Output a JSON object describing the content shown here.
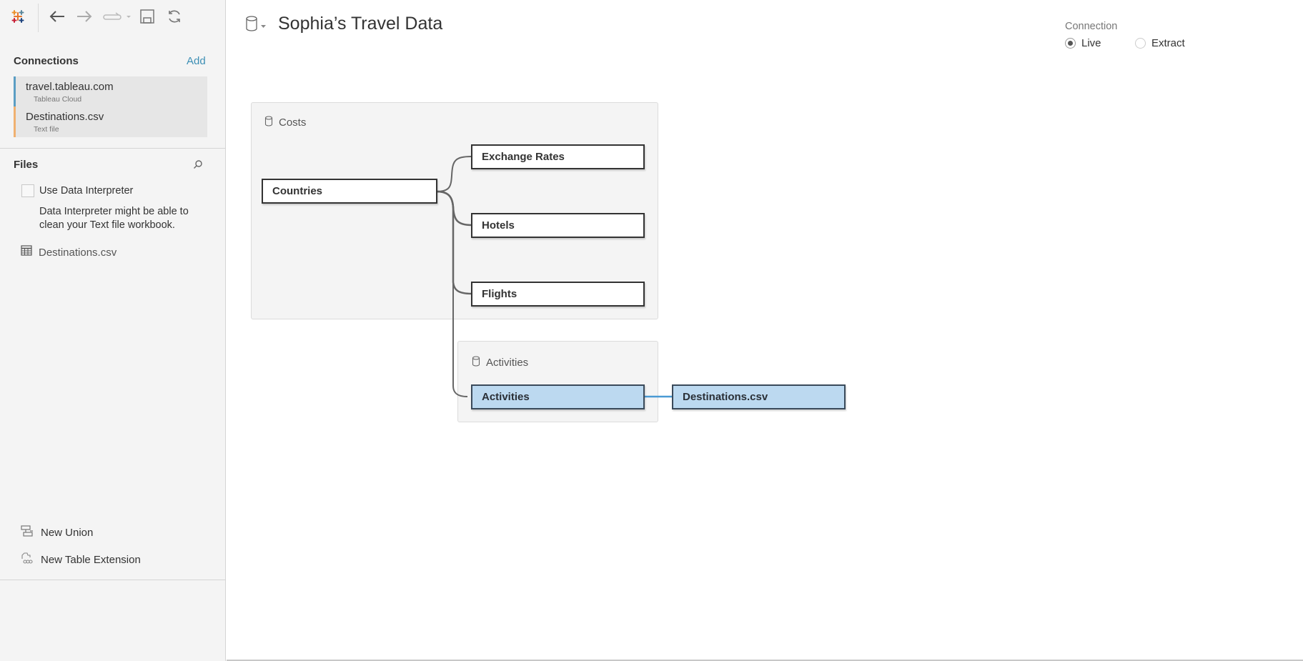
{
  "toolbar": {
    "icons": [
      "tableau-logo-icon",
      "back-icon",
      "forward-icon",
      "redo-icon",
      "save-icon",
      "refresh-icon"
    ]
  },
  "sidebar": {
    "connections_title": "Connections",
    "add_label": "Add",
    "connections": [
      {
        "name": "travel.tableau.com",
        "type": "Tableau Cloud",
        "color": "#5b9ec4"
      },
      {
        "name": "Destinations.csv",
        "type": "Text file",
        "color": "#f0b070"
      }
    ],
    "files_title": "Files",
    "use_interpreter_label": "Use Data Interpreter",
    "use_interpreter_checked": false,
    "interpreter_desc": "Data Interpreter might be able to clean your Text file workbook.",
    "files": [
      {
        "name": "Destinations.csv",
        "icon": "table-grid-icon"
      }
    ],
    "new_union_label": "New Union",
    "new_table_extension_label": "New Table Extension"
  },
  "header": {
    "title": "Sophia’s Travel Data",
    "connection_label": "Connection",
    "connection_options": [
      {
        "label": "Live",
        "selected": true
      },
      {
        "label": "Extract",
        "selected": false
      }
    ]
  },
  "canvas": {
    "panels": [
      {
        "title": "Costs"
      },
      {
        "title": "Activities"
      }
    ],
    "tables": {
      "countries": "Countries",
      "exchange_rates": "Exchange Rates",
      "hotels": "Hotels",
      "flights": "Flights",
      "activities": "Activities",
      "destinations": "Destinations.csv"
    },
    "relationships": [
      [
        "Countries",
        "Exchange Rates"
      ],
      [
        "Countries",
        "Hotels"
      ],
      [
        "Countries",
        "Flights"
      ],
      [
        "Countries",
        "Activities"
      ]
    ],
    "joins": [
      [
        "Activities",
        "Destinations.csv"
      ]
    ],
    "colors": {
      "relationship_line": "#666666",
      "join_line": "#4a9ad4",
      "selected_table_fill": "#bcd9f0"
    }
  }
}
